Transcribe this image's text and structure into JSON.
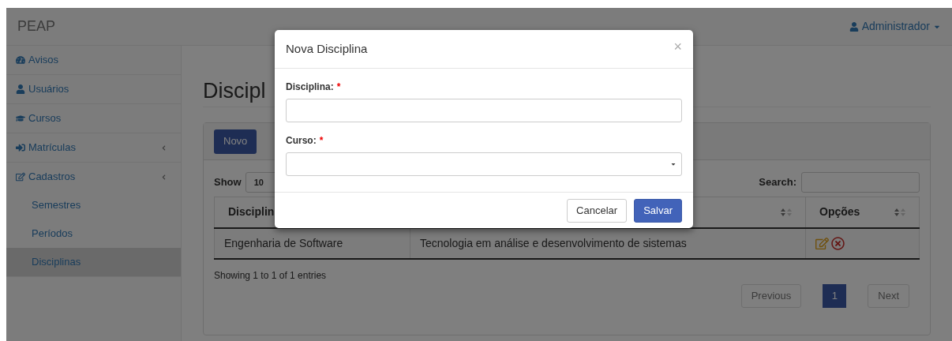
{
  "navbar": {
    "brand": "PEAP",
    "user": "Administrador"
  },
  "sidebar": {
    "items": [
      {
        "kind": "link",
        "label": "Avisos",
        "selected": false
      },
      {
        "kind": "link",
        "label": "Usuários",
        "selected": false
      },
      {
        "kind": "link",
        "label": "Cursos",
        "selected": false
      },
      {
        "kind": "menu",
        "label": "Matrículas",
        "selected": false
      },
      {
        "kind": "menu",
        "label": "Cadastros",
        "selected": false,
        "children": [
          {
            "label": "Semestres",
            "selected": false
          },
          {
            "label": "Períodos",
            "selected": false
          },
          {
            "label": "Disciplinas",
            "selected": true
          }
        ]
      }
    ]
  },
  "page": {
    "heading": "Discipl",
    "new_button": "Novo",
    "show_label": "Show",
    "page_size": "10",
    "search_label": "Search:",
    "table": {
      "columns": [
        "Disciplin",
        "",
        "Opções"
      ],
      "rows": [
        {
          "cells": [
            "Engenharia de Software",
            "Tecnologia em análise e desenvolvimento de sistemas"
          ]
        }
      ]
    },
    "info": "Showing 1 to 1 of 1 entries",
    "pagination": {
      "previous": "Previous",
      "pages": [
        {
          "label": "1",
          "selected": true
        }
      ],
      "next": "Next"
    }
  },
  "modal": {
    "title": "Nova Disciplina",
    "close": "×",
    "fields": [
      {
        "kind": "text",
        "label": "Disciplina:",
        "required_mark": "*"
      },
      {
        "kind": "select",
        "label": "Curso:",
        "required_mark": "*"
      }
    ],
    "buttons": [
      {
        "kind": "default",
        "label": "Cancelar"
      },
      {
        "kind": "primary",
        "label": "Salvar"
      }
    ]
  }
}
